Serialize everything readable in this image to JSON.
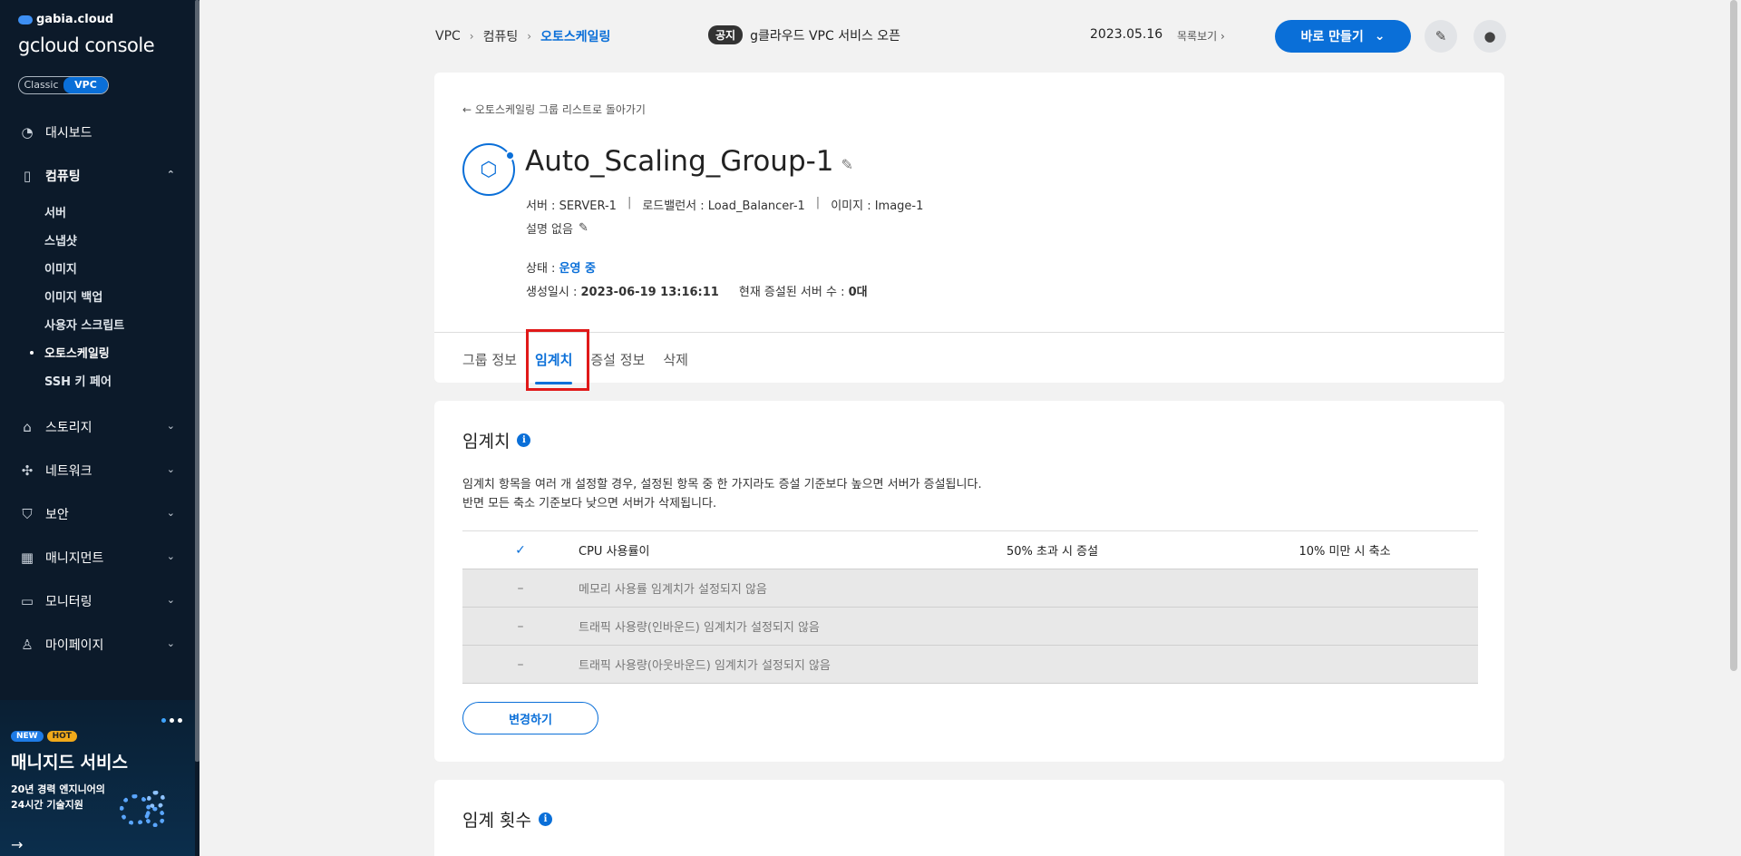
{
  "brand": {
    "company": "gabia.cloud",
    "console": "gcloud console"
  },
  "mode_toggle": {
    "classic": "Classic",
    "vpc": "VPC"
  },
  "sidebar": {
    "items": [
      {
        "label": "대시보드",
        "icon": "dashboard-icon"
      },
      {
        "label": "컴퓨팅",
        "icon": "chip-icon",
        "expanded": true
      },
      {
        "label": "스토리지",
        "icon": "storage-icon"
      },
      {
        "label": "네트워크",
        "icon": "network-icon"
      },
      {
        "label": "보안",
        "icon": "shield-icon"
      },
      {
        "label": "매니지먼트",
        "icon": "management-icon"
      },
      {
        "label": "모니터링",
        "icon": "monitoring-icon"
      },
      {
        "label": "마이페이지",
        "icon": "user-icon"
      }
    ],
    "computing_sub": [
      "서버",
      "스냅샷",
      "이미지",
      "이미지 백업",
      "사용자 스크립트",
      "오토스케일링",
      "SSH 키 페어"
    ],
    "active_sub": "오토스케일링"
  },
  "promo": {
    "badge_new": "NEW",
    "badge_hot": "HOT",
    "title": "매니지드 서비스",
    "subtitle": "20년 경력 엔지니어의\n24시간 기술지원"
  },
  "header": {
    "breadcrumb": [
      "VPC",
      "컴퓨팅",
      "오토스케일링"
    ],
    "notice_tag": "공지",
    "notice_text": "g클라우드 VPC 서비스 오픈",
    "notice_date": "2023.05.16",
    "list_link": "목록보기",
    "make_button": "바로 만들기"
  },
  "group": {
    "back_link": "오토스케일링 그룹 리스트로 돌아가기",
    "name": "Auto_Scaling_Group-1",
    "server": "서버 : SERVER-1",
    "load_balancer": "로드밸런서 : Load_Balancer-1",
    "image": "이미지 : Image-1",
    "description": "설명 없음",
    "status_label": "상태 :",
    "status_value": "운영 중",
    "created_label": "생성일시 :",
    "created_value": "2023-06-19 13:16:11",
    "servers_label": "현재 증설된 서버 수 :",
    "servers_value": "0대"
  },
  "tabs": [
    "그룹 정보",
    "임계치",
    "증설 정보",
    "삭제"
  ],
  "active_tab": "임계치",
  "threshold": {
    "title": "임계치",
    "desc_line1": "임계치 항목을 여러 개 설정할 경우, 설정된 항목 중 한 가지라도 증설 기준보다 높으면 서버가 증설됩니다.",
    "desc_line2": "반면 모든 축소 기준보다 낮으면 서버가 삭제됩니다.",
    "rows": [
      {
        "mark": "✓",
        "name": "CPU 사용률이",
        "up": "50% 초과 시 증설",
        "down": "10% 미만 시 축소",
        "enabled": true
      },
      {
        "mark": "–",
        "name": "메모리 사용률 임계치가 설정되지 않음",
        "up": "",
        "down": "",
        "enabled": false
      },
      {
        "mark": "–",
        "name": "트래픽 사용량(인바운드) 임계치가 설정되지 않음",
        "up": "",
        "down": "",
        "enabled": false
      },
      {
        "mark": "–",
        "name": "트래픽 사용량(아웃바운드) 임계치가 설정되지 않음",
        "up": "",
        "down": "",
        "enabled": false
      }
    ],
    "change_button": "변경하기"
  },
  "threshold_count": {
    "title": "임계 횟수"
  },
  "colors": {
    "accent": "#0a6fd8",
    "sidebar_bg": "#0c1a2a",
    "highlight": "#e01919"
  }
}
